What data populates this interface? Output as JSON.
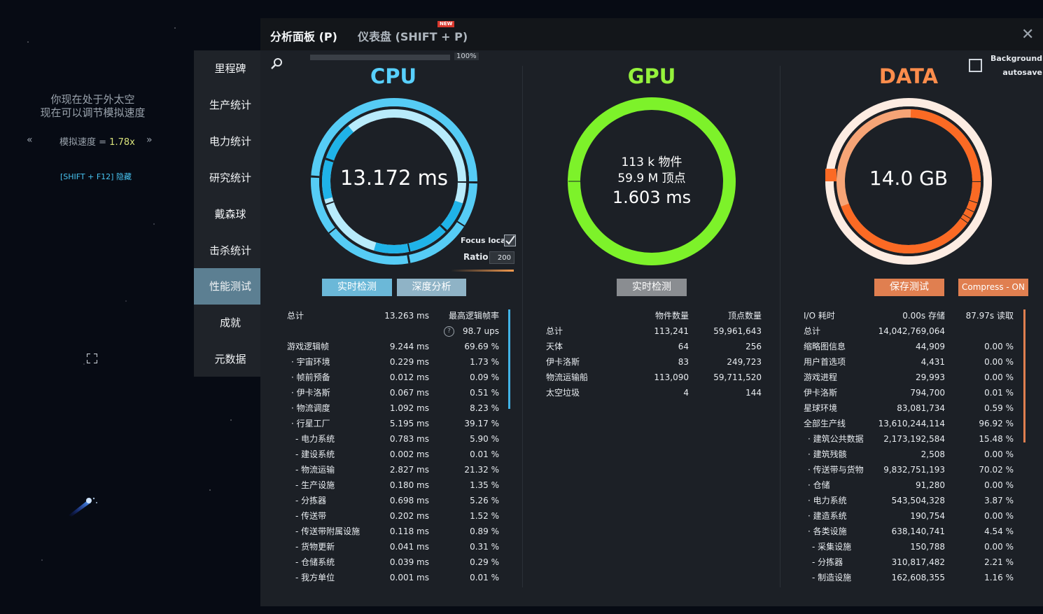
{
  "space_overlay": {
    "line1": "你现在处于外太空",
    "line2": "现在可以调节模拟速度",
    "speed_label": "模拟速度 = ",
    "speed_value": "1.78x",
    "speed_down": "«",
    "speed_up": "»",
    "hide_hint": "[SHIFT + F12] 隐藏"
  },
  "sidebar": {
    "items": [
      {
        "label": "里程碑"
      },
      {
        "label": "生产统计"
      },
      {
        "label": "电力统计"
      },
      {
        "label": "研究统计"
      },
      {
        "label": "戴森球"
      },
      {
        "label": "击杀统计"
      },
      {
        "label": "性能测试",
        "active": true
      },
      {
        "label": "成就"
      },
      {
        "label": "元数据"
      }
    ]
  },
  "header": {
    "tab1": "分析面板 (P)",
    "tab2": "仪表盘 (SHIFT + P)",
    "new_badge": "NEW",
    "close": "✕"
  },
  "progress": {
    "value": 100,
    "label": "100%"
  },
  "background_autosave": {
    "line1": "Background",
    "line2": "autosave",
    "checked": false
  },
  "cpu": {
    "title": "CPU",
    "center_value": "13.172 ms",
    "focus_local": "Focus local",
    "focus_local_checked": true,
    "ratio_label": "Ratio",
    "ratio_value": "200",
    "btn_realtime": "实时检测",
    "btn_deep": "深度分析",
    "header": {
      "total_label": "总计",
      "total_ms": "13.263 ms",
      "rate_label": "最高逻辑帧率",
      "ups": "98.7 ups",
      "help": "?"
    },
    "rows": [
      {
        "name": "游戏逻辑帧",
        "ms": "9.244 ms",
        "pct": "69.69 %"
      },
      {
        "name": "· 宇宙环境",
        "ms": "0.229 ms",
        "pct": "1.73 %"
      },
      {
        "name": "· 帧前预备",
        "ms": "0.012 ms",
        "pct": "0.09 %"
      },
      {
        "name": "· 伊卡洛斯",
        "ms": "0.067 ms",
        "pct": "0.51 %"
      },
      {
        "name": "· 物流调度",
        "ms": "1.092 ms",
        "pct": "8.23 %"
      },
      {
        "name": "· 行星工厂",
        "ms": "5.195 ms",
        "pct": "39.17 %"
      },
      {
        "name": "- 电力系统",
        "ms": "0.783 ms",
        "pct": "5.90 %"
      },
      {
        "name": "- 建设系统",
        "ms": "0.002 ms",
        "pct": "0.01 %"
      },
      {
        "name": "- 物流运输",
        "ms": "2.827 ms",
        "pct": "21.32 %"
      },
      {
        "name": "- 生产设施",
        "ms": "0.180 ms",
        "pct": "1.35 %"
      },
      {
        "name": "- 分拣器",
        "ms": "0.698 ms",
        "pct": "5.26 %"
      },
      {
        "name": "- 传送带",
        "ms": "0.202 ms",
        "pct": "1.52 %"
      },
      {
        "name": "- 传送带附属设施",
        "ms": "0.118 ms",
        "pct": "0.89 %"
      },
      {
        "name": "- 货物更新",
        "ms": "0.041 ms",
        "pct": "0.31 %"
      },
      {
        "name": "- 仓储系统",
        "ms": "0.039 ms",
        "pct": "0.29 %"
      },
      {
        "name": "- 我方单位",
        "ms": "0.001 ms",
        "pct": "0.01 %"
      }
    ]
  },
  "gpu": {
    "title": "GPU",
    "center_line1": "113 k 物件",
    "center_line2": "59.9 M 顶点",
    "center_line3": "1.603 ms",
    "btn_realtime": "实时检测",
    "header": {
      "objects": "物件数量",
      "vertices": "顶点数量"
    },
    "rows": [
      {
        "name": "总计",
        "objects": "113,241",
        "vertices": "59,961,643"
      },
      {
        "name": "天体",
        "objects": "64",
        "vertices": "256"
      },
      {
        "name": "伊卡洛斯",
        "objects": "83",
        "vertices": "249,723"
      },
      {
        "name": "物流运输船",
        "objects": "113,090",
        "vertices": "59,711,520"
      },
      {
        "name": "太空垃圾",
        "objects": "4",
        "vertices": "144"
      }
    ]
  },
  "data": {
    "title": "DATA",
    "center_value": "14.0 GB",
    "btn_save": "保存测试",
    "btn_compress": "Compress - ON",
    "header": {
      "io_label": "I/O 耗时",
      "save": "0.00s 存储",
      "read": "87.97s 读取"
    },
    "rows": [
      {
        "name": "总计",
        "bytes": "14,042,769,064",
        "pct": ""
      },
      {
        "name": "缩略图信息",
        "bytes": "44,909",
        "pct": "0.00 %"
      },
      {
        "name": "用户首选项",
        "bytes": "4,431",
        "pct": "0.00 %"
      },
      {
        "name": "游戏进程",
        "bytes": "29,993",
        "pct": "0.00 %"
      },
      {
        "name": "伊卡洛斯",
        "bytes": "794,700",
        "pct": "0.01 %"
      },
      {
        "name": "星球环境",
        "bytes": "83,081,734",
        "pct": "0.59 %"
      },
      {
        "name": "全部生产线",
        "bytes": "13,610,244,114",
        "pct": "96.92 %"
      },
      {
        "name": "· 建筑公共数据",
        "bytes": "2,173,192,584",
        "pct": "15.48 %"
      },
      {
        "name": "· 建筑残骸",
        "bytes": "2,508",
        "pct": "0.00 %"
      },
      {
        "name": "· 传送带与货物",
        "bytes": "9,832,751,193",
        "pct": "70.02 %"
      },
      {
        "name": "· 仓储",
        "bytes": "91,280",
        "pct": "0.00 %"
      },
      {
        "name": "· 电力系统",
        "bytes": "543,504,328",
        "pct": "3.87 %"
      },
      {
        "name": "· 建造系统",
        "bytes": "190,754",
        "pct": "0.00 %"
      },
      {
        "name": "· 各类设施",
        "bytes": "638,140,741",
        "pct": "4.54 %"
      },
      {
        "name": "- 采集设施",
        "bytes": "150,788",
        "pct": "0.00 %"
      },
      {
        "name": "- 分拣器",
        "bytes": "310,817,482",
        "pct": "2.21 %"
      },
      {
        "name": "- 制造设施",
        "bytes": "162,608,355",
        "pct": "1.16 %"
      }
    ]
  },
  "colors": {
    "cpu": "#58d0ff",
    "gpu": "#95f23c",
    "data": "#ff8d4c",
    "panel": "#1c2026",
    "sidebar_active": "#5c7f92"
  }
}
